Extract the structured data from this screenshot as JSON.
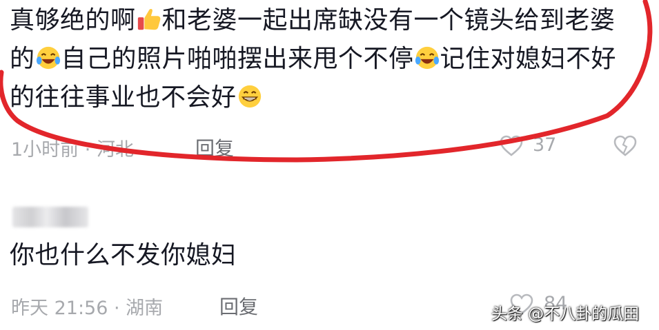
{
  "comment1": {
    "seg1": "真够绝的啊",
    "seg2": "和老婆一起出席缺没有一个镜头给到老婆的",
    "seg3": "自己的照片啪啪摆出来甩个不停",
    "seg4": "记住对媳妇不好的往往事业也不会好",
    "meta": "1小时前 · 河北",
    "reply_label": "回复",
    "like_count": "37",
    "emojis": [
      "thumbs-up",
      "laughing-tears",
      "laughing-tears",
      "grinning"
    ]
  },
  "comment2": {
    "text": "你也什么不发你媳妇",
    "meta": "昨天 21:56 · 湖南",
    "reply_label": "回复",
    "like_count": "84"
  },
  "watermark": "头条 @不八卦的瓜田",
  "colors": {
    "text": "#161823",
    "meta": "#a7a9ad",
    "highlight_ring": "#e2262b"
  }
}
